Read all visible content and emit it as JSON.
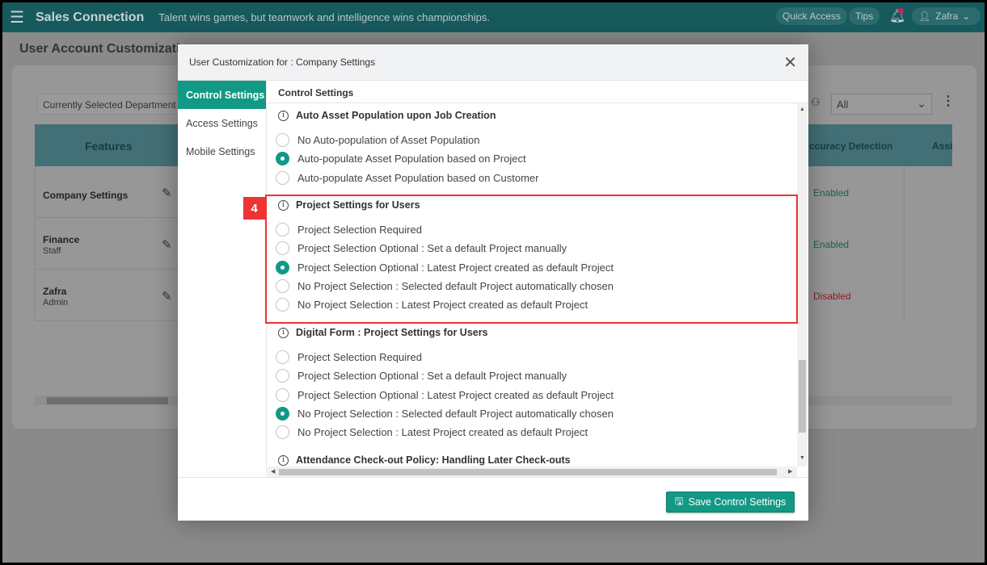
{
  "header": {
    "brand": "Sales Connection",
    "tagline": "Talent wins games, but teamwork and intelligence wins championships.",
    "quick_access": "Quick Access",
    "tips": "Tips",
    "user": "Zafra"
  },
  "page": {
    "title": "User Account Customization",
    "department_placeholder": "Currently Selected Department",
    "filter_value": "All",
    "columns": [
      "Features",
      "ccuracy Detection",
      "Assi"
    ],
    "rows": [
      {
        "name": "Company Settings",
        "sub": "",
        "status": "Enabled"
      },
      {
        "name": "Finance",
        "sub": "Staff",
        "status": "Enabled"
      },
      {
        "name": "Zafra",
        "sub": "Admin",
        "status": "Disabled"
      }
    ]
  },
  "modal": {
    "title": "User Customization for : Company Settings",
    "nav": [
      "Control Settings",
      "Access Settings",
      "Mobile Settings"
    ],
    "content_title": "Control Settings",
    "sections": [
      {
        "title": "Auto Asset Population upon Job Creation",
        "options": [
          "No Auto-population of Asset Population",
          "Auto-populate Asset Population based on Project",
          "Auto-populate Asset Population based on Customer"
        ],
        "selected": 1
      },
      {
        "title": "Project Settings for Users",
        "options": [
          "Project Selection Required",
          "Project Selection Optional : Set a default Project manually",
          "Project Selection Optional : Latest Project created as default Project",
          "No Project Selection : Selected default Project automatically chosen",
          "No Project Selection : Latest Project created as default Project"
        ],
        "selected": 2
      },
      {
        "title": "Digital Form : Project Settings for Users",
        "options": [
          "Project Selection Required",
          "Project Selection Optional : Set a default Project manually",
          "Project Selection Optional : Latest Project created as default Project",
          "No Project Selection : Selected default Project automatically chosen",
          "No Project Selection : Latest Project created as default Project"
        ],
        "selected": 3
      },
      {
        "title": "Attendance Check-out Policy: Handling Later Check-outs",
        "options": [],
        "selected": -1
      }
    ],
    "annotation_number": "4",
    "save_label": "Save Control Settings"
  },
  "colors": {
    "accent": "#119985",
    "highlight": "#ee3333",
    "header": "#175a5e"
  }
}
